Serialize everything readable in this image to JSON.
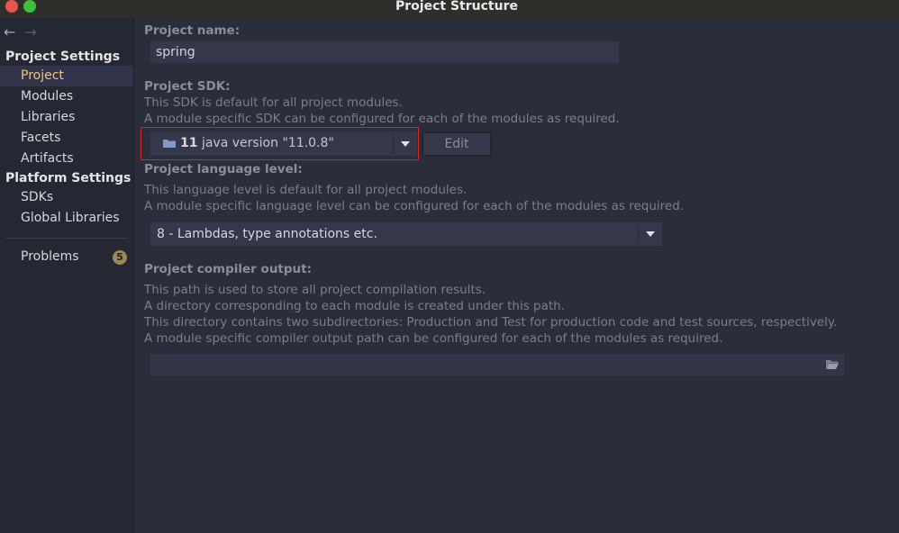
{
  "window": {
    "title": "Project Structure"
  },
  "sidebar": {
    "nav": {
      "back": "←",
      "forward": "→"
    },
    "project_settings": {
      "heading": "Project Settings",
      "items": [
        "Project",
        "Modules",
        "Libraries",
        "Facets",
        "Artifacts"
      ]
    },
    "platform_settings": {
      "heading": "Platform Settings",
      "items": [
        "SDKs",
        "Global Libraries"
      ]
    },
    "problems": {
      "label": "Problems",
      "count": "5"
    }
  },
  "main": {
    "project_name": {
      "label": "Project name:",
      "value": "spring"
    },
    "project_sdk": {
      "label": "Project SDK:",
      "desc1": "This SDK is default for all project modules.",
      "desc2": "A module specific SDK can be configured for each of the modules as required.",
      "selected_version": "11",
      "selected_detail": "java version \"11.0.8\"",
      "edit_label": "Edit"
    },
    "language_level": {
      "label": "Project language level:",
      "desc1": "This language level is default for all project modules.",
      "desc2": "A module specific language level can be configured for each of the modules as required.",
      "value": "8 - Lambdas, type annotations etc."
    },
    "compiler_output": {
      "label": "Project compiler output:",
      "desc1": "This path is used to store all project compilation results.",
      "desc2": "A directory corresponding to each module is created under this path.",
      "desc3": "This directory contains two subdirectories: Production and Test for production code and test sources, respectively.",
      "desc4": "A module specific compiler output path can be configured for each of the modules as required.",
      "value": ""
    }
  },
  "colors": {
    "selected_item": "#f0c674",
    "highlight_border": "#d8252b",
    "badge": "#a08654"
  }
}
